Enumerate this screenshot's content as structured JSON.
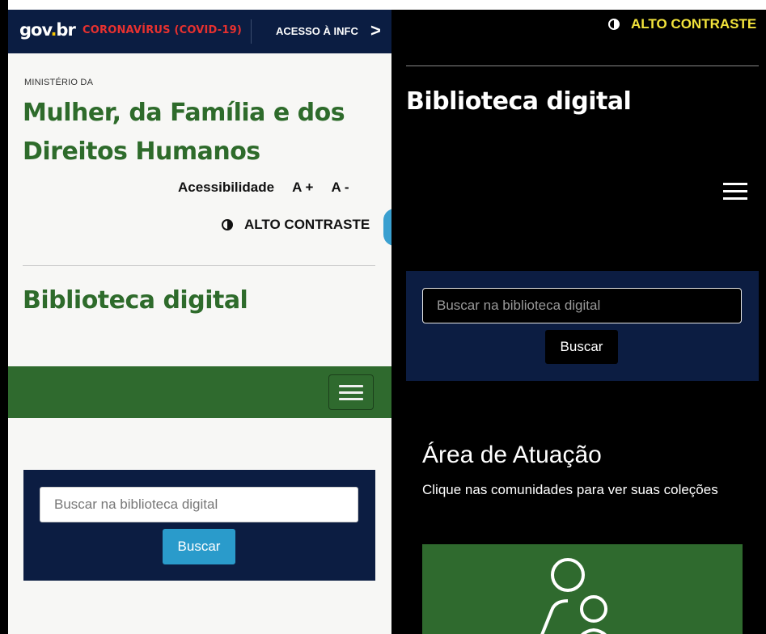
{
  "left": {
    "topbar": {
      "logo": "gov.br",
      "covid_link": "CORONAVÍRUS (COVID-19)",
      "acesso_link": "ACESSO À INFC",
      "chevron": ">"
    },
    "ministry_small": "MINISTÉRIO DA",
    "ministry_name": "Mulher, da Família e dos Direitos Humanos",
    "accessibility": {
      "label": "Acessibilidade",
      "increase": "A +",
      "decrease": "A -"
    },
    "contrast_label": "ALTO CONTRASTE",
    "page_title": "Biblioteca digital",
    "search": {
      "placeholder": "Buscar na biblioteca digital",
      "button": "Buscar"
    }
  },
  "right": {
    "contrast_label": "ALTO CONTRASTE",
    "page_title": "Biblioteca digital",
    "search": {
      "placeholder": "Buscar na biblioteca digital",
      "button": "Buscar"
    },
    "section_title": "Área de Atuação",
    "section_subtitle": "Clique nas comunidades para ver suas coleções"
  },
  "colors": {
    "brand_green": "#2e6b2b",
    "navy": "#0c1d42",
    "accent_blue": "#2a9bcb",
    "contrast_yellow": "#f2e33b",
    "covid_red": "#e8312f"
  },
  "icons": [
    "contrast-icon",
    "menu-icon",
    "chevron-right-icon",
    "community-icon"
  ]
}
